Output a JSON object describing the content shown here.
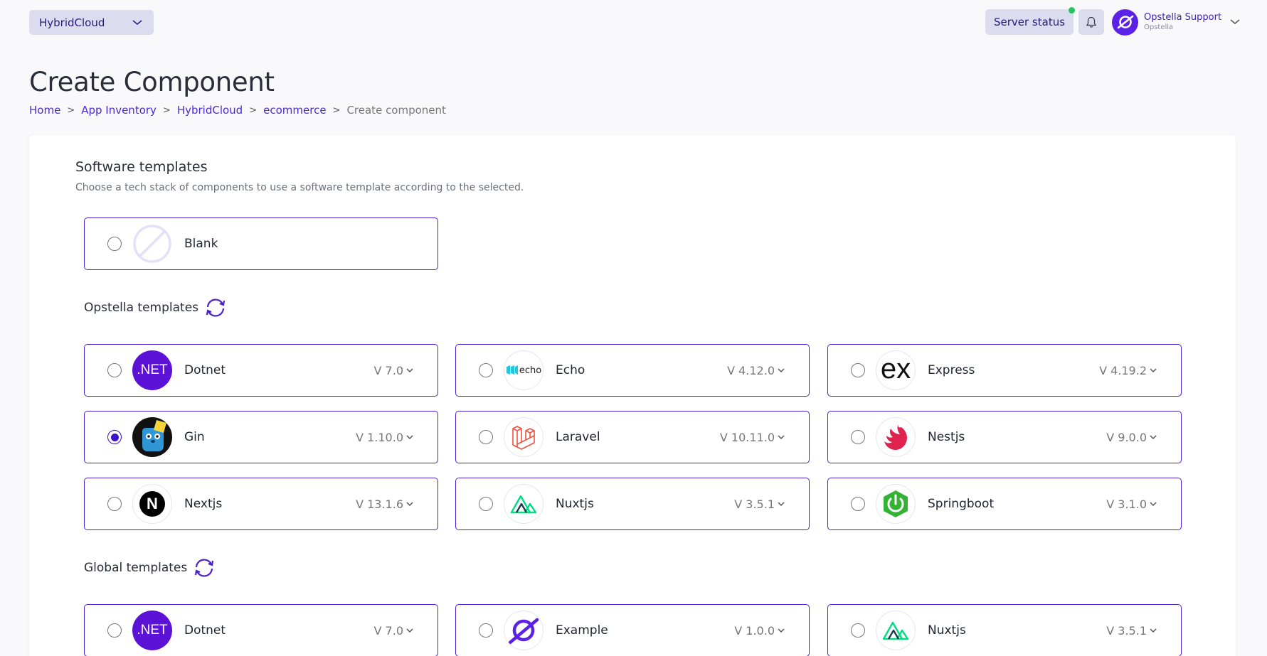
{
  "header": {
    "workspace": "HybridCloud",
    "server_status": "Server status",
    "user_name": "Opstella Support",
    "user_org": "Opstella"
  },
  "page": {
    "title": "Create Component",
    "breadcrumb": [
      "Home",
      "App Inventory",
      "HybridCloud",
      "ecommerce",
      "Create component"
    ]
  },
  "software_templates": {
    "heading": "Software templates",
    "description": "Choose a tech stack of components to use a software template according to the selected.",
    "blank_label": "Blank"
  },
  "opstella_templates": {
    "heading": "Opstella templates",
    "items": [
      {
        "name": "Dotnet",
        "version": "V 7.0",
        "icon": "dotnet-icon",
        "selected": false
      },
      {
        "name": "Echo",
        "version": "V 4.12.0",
        "icon": "echo-icon",
        "selected": false
      },
      {
        "name": "Express",
        "version": "V 4.19.2",
        "icon": "express-icon",
        "selected": false
      },
      {
        "name": "Gin",
        "version": "V 1.10.0",
        "icon": "gin-icon",
        "selected": true
      },
      {
        "name": "Laravel",
        "version": "V 10.11.0",
        "icon": "laravel-icon",
        "selected": false
      },
      {
        "name": "Nestjs",
        "version": "V 9.0.0",
        "icon": "nestjs-icon",
        "selected": false
      },
      {
        "name": "Nextjs",
        "version": "V 13.1.6",
        "icon": "nextjs-icon",
        "selected": false
      },
      {
        "name": "Nuxtjs",
        "version": "V 3.5.1",
        "icon": "nuxtjs-icon",
        "selected": false
      },
      {
        "name": "Springboot",
        "version": "V 3.1.0",
        "icon": "springboot-icon",
        "selected": false
      }
    ]
  },
  "global_templates": {
    "heading": "Global templates",
    "items": [
      {
        "name": "Dotnet",
        "version": "V 7.0",
        "icon": "dotnet-icon",
        "selected": false
      },
      {
        "name": "Example",
        "version": "V 1.0.0",
        "icon": "example-icon",
        "selected": false
      },
      {
        "name": "Nuxtjs",
        "version": "V 3.5.1",
        "icon": "nuxtjs-icon",
        "selected": false
      }
    ]
  },
  "logo_text": {
    "dotnet": ".NET",
    "echo": "echo",
    "express": "ex",
    "nextjs": "N"
  },
  "colors": {
    "accent": "#4a1fd0",
    "dotnet": "#5b12d6",
    "laravel": "#f05340",
    "nestjs": "#e0234e",
    "nuxt": "#00dc82",
    "springboot": "#34b233",
    "status_online": "#22c55e"
  }
}
